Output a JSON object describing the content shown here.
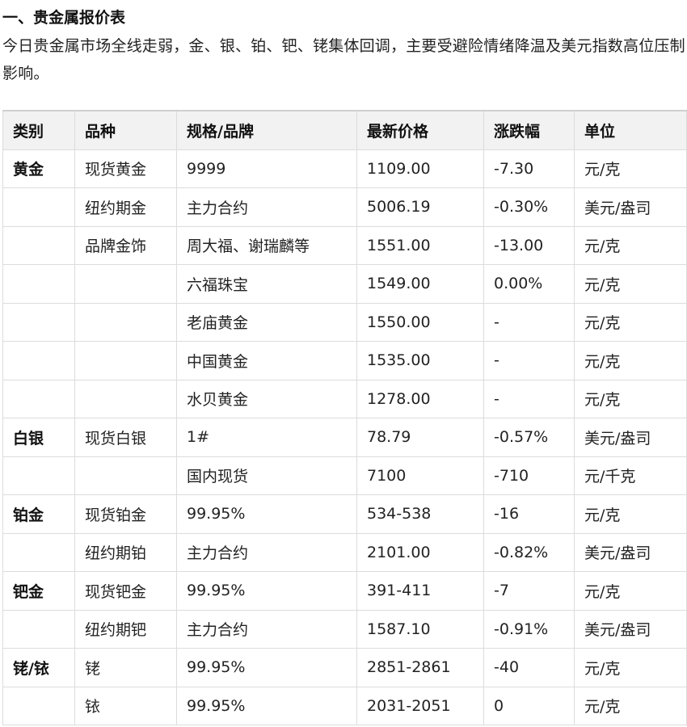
{
  "heading": "一、贵金属报价表",
  "intro": "今日贵金属市场全线走弱，金、银、铂、钯、铑集体回调，主要受避险情绪降温及美元指数高位压制影响。",
  "table": {
    "headers": [
      "类别",
      "品种",
      "规格/品牌",
      "最新价格",
      "涨跌幅",
      "单位"
    ],
    "rows": [
      [
        "黄金",
        "现货黄金",
        "9999",
        "1109.00",
        "-7.30",
        "元/克"
      ],
      [
        "",
        "纽约期金",
        "主力合约",
        "5006.19",
        "-0.30%",
        "美元/盎司"
      ],
      [
        "",
        "品牌金饰",
        "周大福、谢瑞麟等",
        "1551.00",
        "-13.00",
        "元/克"
      ],
      [
        "",
        "",
        "六福珠宝",
        "1549.00",
        "0.00%",
        "元/克"
      ],
      [
        "",
        "",
        "老庙黄金",
        "1550.00",
        "-",
        "元/克"
      ],
      [
        "",
        "",
        "中国黄金",
        "1535.00",
        "-",
        "元/克"
      ],
      [
        "",
        "",
        "水贝黄金",
        "1278.00",
        "-",
        "元/克"
      ],
      [
        "白银",
        "现货白银",
        "1#",
        "78.79",
        "-0.57%",
        "美元/盎司"
      ],
      [
        "",
        "",
        "国内现货",
        "7100",
        "-710",
        "元/千克"
      ],
      [
        "铂金",
        "现货铂金",
        "99.95%",
        "534-538",
        "-16",
        "元/克"
      ],
      [
        "",
        "纽约期铂",
        "主力合约",
        "2101.00",
        "-0.82%",
        "美元/盎司"
      ],
      [
        "钯金",
        "现货钯金",
        "99.95%",
        "391-411",
        "-7",
        "元/克"
      ],
      [
        "",
        "纽约期钯",
        "主力合约",
        "1587.10",
        "-0.91%",
        "美元/盎司"
      ],
      [
        "铑/铱",
        "铑",
        "99.95%",
        "2851-2861",
        "-40",
        "元/克"
      ],
      [
        "",
        "铱",
        "99.95%",
        "2031-2051",
        "0",
        "元/克"
      ]
    ]
  }
}
